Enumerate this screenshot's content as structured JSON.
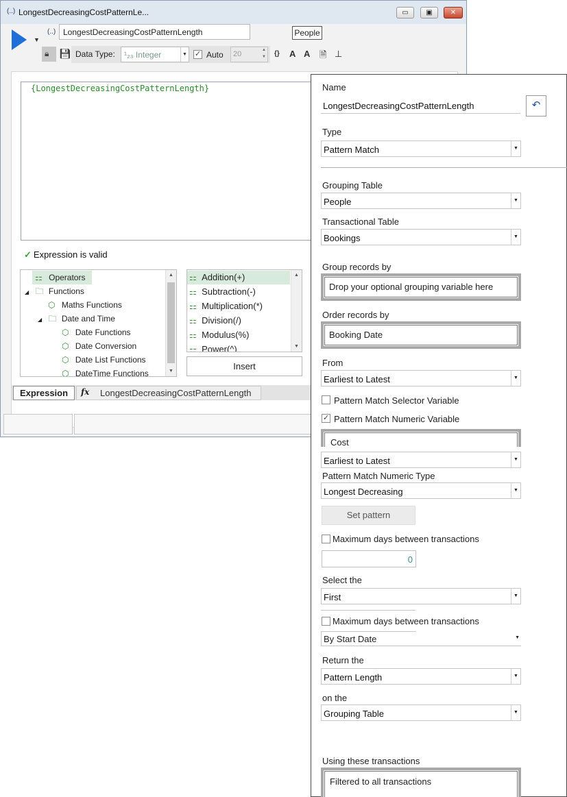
{
  "window": {
    "title": "LongestDecreasingCostPatternLe...",
    "title_icon": "(..)",
    "variable_name": "LongestDecreasingCostPatternLength",
    "name_prefix_icon": "(..)",
    "context_button": "People",
    "controls": {
      "minimize": "▭",
      "maximize": "▣",
      "close": "✕"
    }
  },
  "toolbar": {
    "data_type_label": "Data Type:",
    "data_type_value": "¹₂₃ Integer",
    "auto_label": "Auto",
    "auto_checked": true,
    "auto_value": "20"
  },
  "editor": {
    "expression": "{LongestDecreasingCostPatternLength}",
    "status": "Expression is valid",
    "tree": [
      {
        "label": "Operators",
        "level": 1,
        "icon": "operators-icon",
        "expander": "",
        "selected": true
      },
      {
        "label": "Functions",
        "level": 0,
        "icon": "folder-icon",
        "expander": "◢",
        "selected": false
      },
      {
        "label": "Maths Functions",
        "level": 2,
        "icon": "cube-icon",
        "expander": "",
        "selected": false
      },
      {
        "label": "Date and Time",
        "level": 1,
        "icon": "folder-icon",
        "expander": "◢",
        "selected": false
      },
      {
        "label": "Date Functions",
        "level": 3,
        "icon": "cube-icon",
        "expander": "",
        "selected": false
      },
      {
        "label": "Date Conversion",
        "level": 3,
        "icon": "cube-icon",
        "expander": "",
        "selected": false
      },
      {
        "label": "Date List Functions",
        "level": 3,
        "icon": "cube-icon",
        "expander": "",
        "selected": false
      },
      {
        "label": "DateTime Functions",
        "level": 3,
        "icon": "cube-icon",
        "expander": "",
        "selected": false
      }
    ],
    "operators": [
      "Addition(+)",
      "Subtraction(-)",
      "Multiplication(*)",
      "Division(/)",
      "Modulus(%)",
      "Power(^)"
    ],
    "insert_label": "Insert",
    "tab_expression": "Expression",
    "tab_fx_symbol": "fx",
    "tab_fx_label": "LongestDecreasingCostPatternLength"
  },
  "panel": {
    "name_label": "Name",
    "name_value": "LongestDecreasingCostPatternLength",
    "type_label": "Type",
    "type_value": "Pattern Match",
    "grouping_table_label": "Grouping Table",
    "grouping_table_value": "People",
    "transactional_table_label": "Transactional Table",
    "transactional_table_value": "Bookings",
    "group_records_label": "Group records by",
    "group_records_value": "Drop your optional grouping variable here",
    "order_records_label": "Order records by",
    "order_records_value": "Booking Date",
    "from_label": "From",
    "from_value": "Earliest to Latest",
    "selector_variable_label": "Pattern Match Selector Variable",
    "selector_variable_checked": false,
    "numeric_variable_label": "Pattern Match Numeric Variable",
    "numeric_variable_checked": true,
    "numeric_variable_value": "Cost",
    "numeric_order_value": "Earliest to Latest",
    "numeric_type_label": "Pattern Match Numeric Type",
    "numeric_type_value": "Longest Decreasing",
    "set_pattern_label": "Set pattern",
    "max_days_label_1": "Maximum days between transactions",
    "max_days_checked_1": false,
    "max_days_value": "0",
    "select_the_label": "Select the",
    "select_the_value": "First",
    "max_days_label_2": "Maximum days between transactions",
    "max_days_checked_2": false,
    "by_start_date_value": "By Start Date",
    "return_the_label": "Return the",
    "return_the_value": "Pattern Length",
    "on_the_label": "on the",
    "on_the_value": "Grouping Table",
    "using_transactions_label": "Using these transactions",
    "using_transactions_value": "Filtered to all transactions"
  }
}
